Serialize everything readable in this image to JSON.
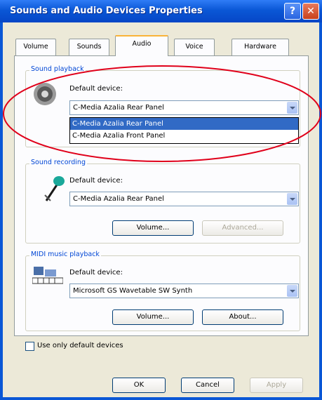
{
  "window": {
    "title": "Sounds and Audio Devices Properties",
    "help_label": "?",
    "close_label": "✕"
  },
  "tabs": [
    {
      "label": "Volume",
      "active": false
    },
    {
      "label": "Sounds",
      "active": false
    },
    {
      "label": "Audio",
      "active": true
    },
    {
      "label": "Voice",
      "active": false
    },
    {
      "label": "Hardware",
      "active": false
    }
  ],
  "sound_playback": {
    "group_label": "Sound playback",
    "default_device_label": "Default device:",
    "selected": "C-Media Azalia Rear Panel",
    "options": [
      "C-Media Azalia Rear Panel",
      "C-Media Azalia Front Panel"
    ]
  },
  "sound_recording": {
    "group_label": "Sound recording",
    "default_device_label": "Default device:",
    "selected": "C-Media Azalia Rear Panel",
    "volume_label": "Volume...",
    "advanced_label": "Advanced..."
  },
  "midi_playback": {
    "group_label": "MIDI music playback",
    "default_device_label": "Default device:",
    "selected": "Microsoft GS Wavetable SW Synth",
    "volume_label": "Volume...",
    "about_label": "About..."
  },
  "use_only_default": {
    "label": "Use only default devices",
    "checked": false
  },
  "footer": {
    "ok_label": "OK",
    "cancel_label": "Cancel",
    "apply_label": "Apply"
  },
  "annotation": {
    "color": "#e0001a"
  }
}
